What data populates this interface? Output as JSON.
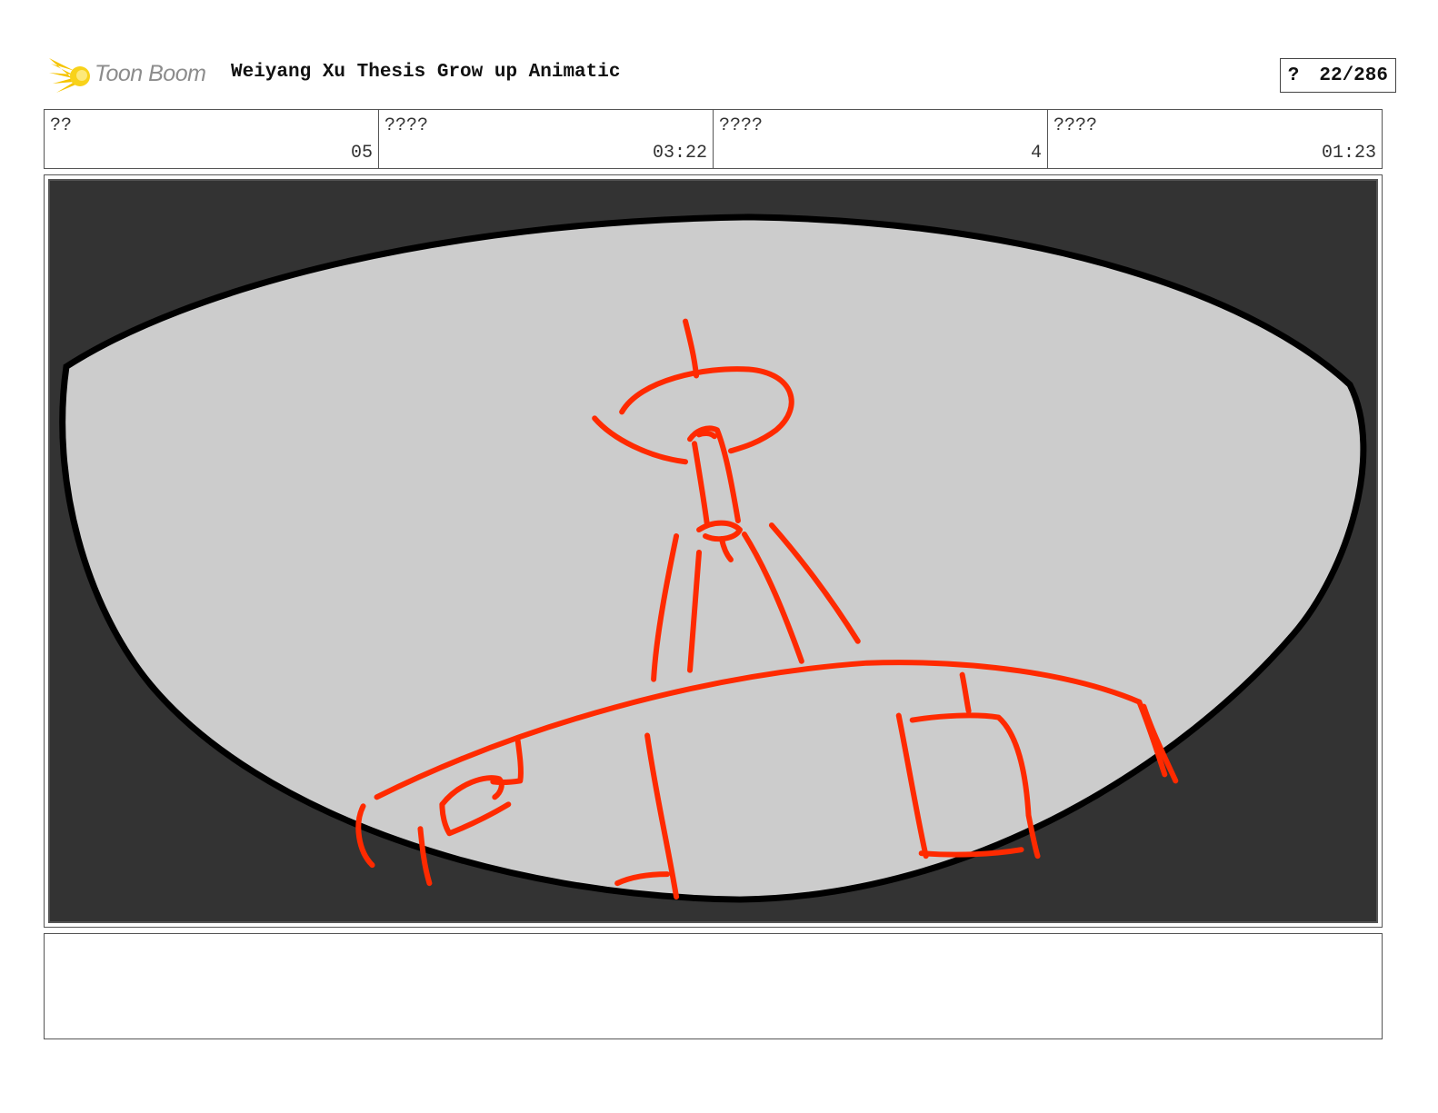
{
  "header": {
    "logo_text": "Toon Boom",
    "title": "Weiyang Xu Thesis Grow up Animatic",
    "page_prefix": "?",
    "page_number": "22/286"
  },
  "info_table": [
    {
      "label": "??",
      "value": "05"
    },
    {
      "label": "????",
      "value": "03:22"
    },
    {
      "label": "????",
      "value": "4"
    },
    {
      "label": "????",
      "value": "01:23"
    }
  ],
  "panel": {
    "sketch_color": "#ff2a00",
    "background_color": "#333333",
    "lens_fill_color": "#cccccc"
  },
  "notes": {
    "text": ""
  }
}
